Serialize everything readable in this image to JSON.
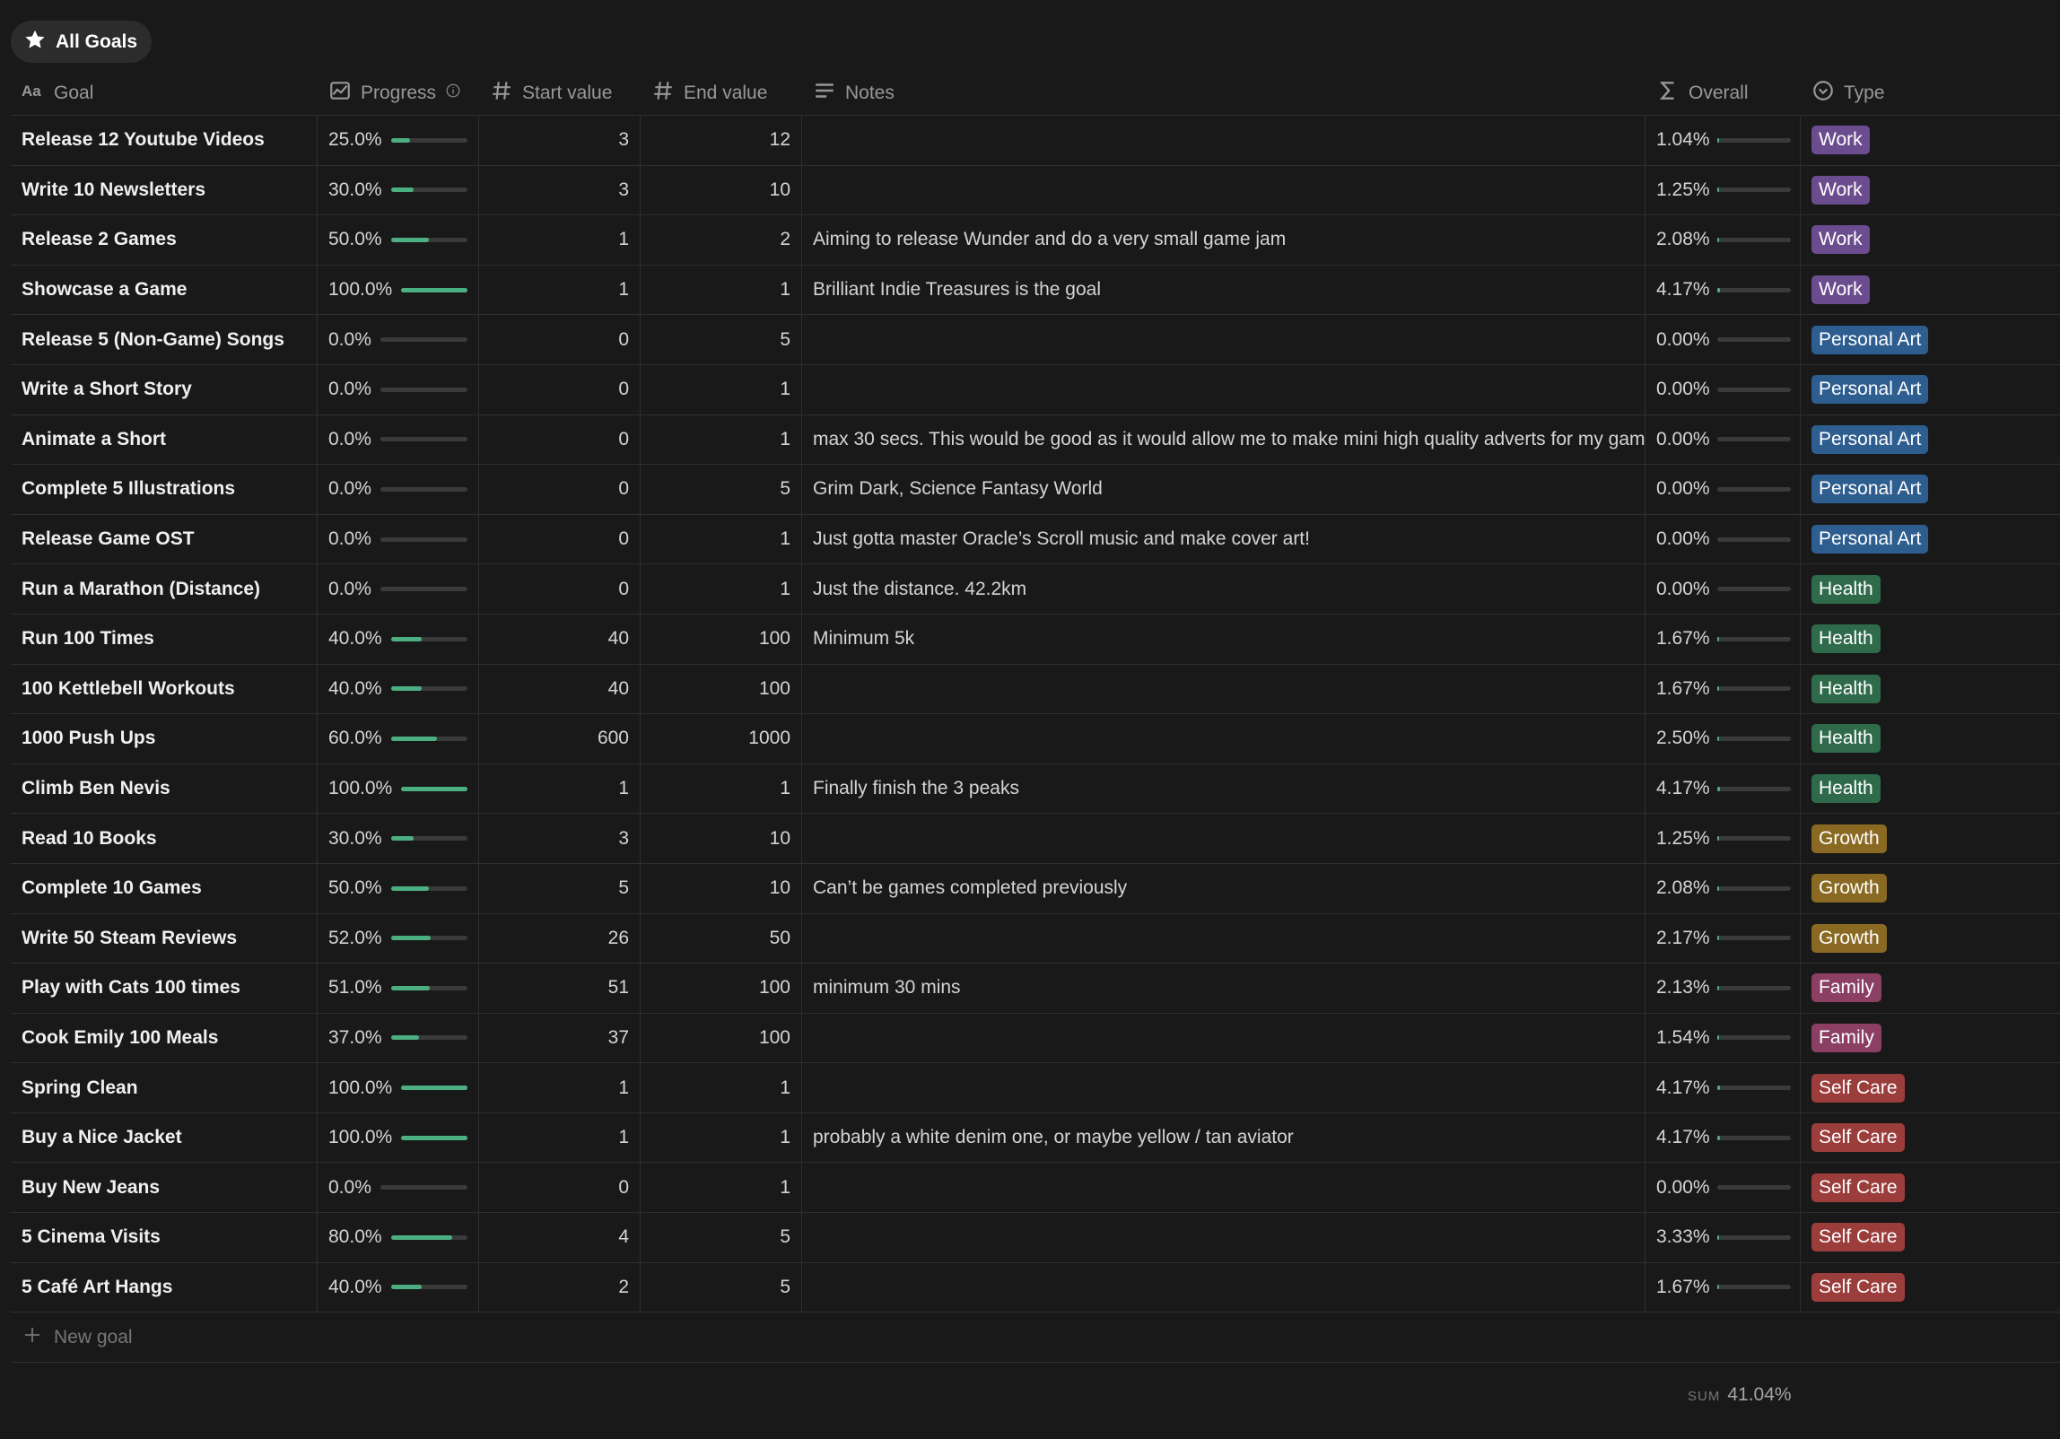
{
  "view": {
    "label": "All Goals",
    "icon": "star-icon"
  },
  "columns": {
    "goal": "Goal",
    "progress": "Progress",
    "start": "Start value",
    "end": "End value",
    "notes": "Notes",
    "overall": "Overall",
    "type": "Type"
  },
  "type_colors": {
    "Work": "#6b4c8f",
    "Personal Art": "#2e5d8f",
    "Health": "#2f6b4a",
    "Growth": "#8a6a22",
    "Family": "#8a3f63",
    "Self Care": "#9a3d3b"
  },
  "rows": [
    {
      "goal": "Release 12 Youtube Videos",
      "progress": "25.0%",
      "progress_value": 0.25,
      "start": "3",
      "end": "12",
      "notes": "",
      "overall": "1.04%",
      "overall_value": 0.0104,
      "type": "Work"
    },
    {
      "goal": "Write 10 Newsletters",
      "progress": "30.0%",
      "progress_value": 0.3,
      "start": "3",
      "end": "10",
      "notes": "",
      "overall": "1.25%",
      "overall_value": 0.0125,
      "type": "Work"
    },
    {
      "goal": "Release 2 Games",
      "progress": "50.0%",
      "progress_value": 0.5,
      "start": "1",
      "end": "2",
      "notes": "Aiming to release Wunder and do a very small game jam",
      "overall": "2.08%",
      "overall_value": 0.0208,
      "type": "Work"
    },
    {
      "goal": "Showcase a Game",
      "progress": "100.0%",
      "progress_value": 1.0,
      "start": "1",
      "end": "1",
      "notes": "Brilliant Indie Treasures is the goal",
      "overall": "4.17%",
      "overall_value": 0.0417,
      "type": "Work"
    },
    {
      "goal": "Release 5 (Non-Game) Songs",
      "progress": "0.0%",
      "progress_value": 0,
      "start": "0",
      "end": "5",
      "notes": "",
      "overall": "0.00%",
      "overall_value": 0,
      "type": "Personal Art"
    },
    {
      "goal": "Write a Short Story",
      "progress": "0.0%",
      "progress_value": 0,
      "start": "0",
      "end": "1",
      "notes": "",
      "overall": "0.00%",
      "overall_value": 0,
      "type": "Personal Art"
    },
    {
      "goal": "Animate a Short",
      "progress": "0.0%",
      "progress_value": 0,
      "start": "0",
      "end": "1",
      "notes": "max 30 secs. This would be good as it would allow me to make mini high quality adverts for my gam",
      "overall": "0.00%",
      "overall_value": 0,
      "type": "Personal Art"
    },
    {
      "goal": "Complete 5 Illustrations",
      "progress": "0.0%",
      "progress_value": 0,
      "start": "0",
      "end": "5",
      "notes": "Grim Dark, Science Fantasy World",
      "overall": "0.00%",
      "overall_value": 0,
      "type": "Personal Art"
    },
    {
      "goal": "Release Game OST",
      "progress": "0.0%",
      "progress_value": 0,
      "start": "0",
      "end": "1",
      "notes": "Just gotta master Oracle’s Scroll music and make cover art!",
      "overall": "0.00%",
      "overall_value": 0,
      "type": "Personal Art"
    },
    {
      "goal": "Run a Marathon (Distance)",
      "progress": "0.0%",
      "progress_value": 0,
      "start": "0",
      "end": "1",
      "notes": "Just the distance. 42.2km",
      "overall": "0.00%",
      "overall_value": 0,
      "type": "Health"
    },
    {
      "goal": "Run 100 Times",
      "progress": "40.0%",
      "progress_value": 0.4,
      "start": "40",
      "end": "100",
      "notes": "Minimum 5k",
      "overall": "1.67%",
      "overall_value": 0.0167,
      "type": "Health"
    },
    {
      "goal": "100 Kettlebell Workouts",
      "progress": "40.0%",
      "progress_value": 0.4,
      "start": "40",
      "end": "100",
      "notes": "",
      "overall": "1.67%",
      "overall_value": 0.0167,
      "type": "Health"
    },
    {
      "goal": "1000 Push Ups",
      "progress": "60.0%",
      "progress_value": 0.6,
      "start": "600",
      "end": "1000",
      "notes": "",
      "overall": "2.50%",
      "overall_value": 0.025,
      "type": "Health"
    },
    {
      "goal": "Climb Ben Nevis",
      "progress": "100.0%",
      "progress_value": 1.0,
      "start": "1",
      "end": "1",
      "notes": "Finally finish the 3 peaks",
      "overall": "4.17%",
      "overall_value": 0.0417,
      "type": "Health"
    },
    {
      "goal": "Read 10 Books",
      "progress": "30.0%",
      "progress_value": 0.3,
      "start": "3",
      "end": "10",
      "notes": "",
      "overall": "1.25%",
      "overall_value": 0.0125,
      "type": "Growth"
    },
    {
      "goal": "Complete 10 Games",
      "progress": "50.0%",
      "progress_value": 0.5,
      "start": "5",
      "end": "10",
      "notes": "Can’t be games completed previously",
      "overall": "2.08%",
      "overall_value": 0.0208,
      "type": "Growth"
    },
    {
      "goal": "Write 50 Steam Reviews",
      "progress": "52.0%",
      "progress_value": 0.52,
      "start": "26",
      "end": "50",
      "notes": "",
      "overall": "2.17%",
      "overall_value": 0.0217,
      "type": "Growth"
    },
    {
      "goal": "Play with Cats 100 times",
      "progress": "51.0%",
      "progress_value": 0.51,
      "start": "51",
      "end": "100",
      "notes": "minimum 30 mins",
      "overall": "2.13%",
      "overall_value": 0.0213,
      "type": "Family"
    },
    {
      "goal": "Cook Emily 100 Meals",
      "progress": "37.0%",
      "progress_value": 0.37,
      "start": "37",
      "end": "100",
      "notes": "",
      "overall": "1.54%",
      "overall_value": 0.0154,
      "type": "Family"
    },
    {
      "goal": "Spring Clean",
      "progress": "100.0%",
      "progress_value": 1.0,
      "start": "1",
      "end": "1",
      "notes": "",
      "overall": "4.17%",
      "overall_value": 0.0417,
      "type": "Self Care"
    },
    {
      "goal": "Buy a Nice Jacket",
      "progress": "100.0%",
      "progress_value": 1.0,
      "start": "1",
      "end": "1",
      "notes": "probably a white denim one, or maybe yellow / tan aviator",
      "overall": "4.17%",
      "overall_value": 0.0417,
      "type": "Self Care"
    },
    {
      "goal": "Buy New Jeans",
      "progress": "0.0%",
      "progress_value": 0,
      "start": "0",
      "end": "1",
      "notes": "",
      "overall": "0.00%",
      "overall_value": 0,
      "type": "Self Care"
    },
    {
      "goal": "5 Cinema Visits",
      "progress": "80.0%",
      "progress_value": 0.8,
      "start": "4",
      "end": "5",
      "notes": "",
      "overall": "3.33%",
      "overall_value": 0.0333,
      "type": "Self Care"
    },
    {
      "goal": "5 Café Art Hangs",
      "progress": "40.0%",
      "progress_value": 0.4,
      "start": "2",
      "end": "5",
      "notes": "",
      "overall": "1.67%",
      "overall_value": 0.0167,
      "type": "Self Care"
    }
  ],
  "new_row_label": "New goal",
  "footer": {
    "sum_label": "SUM",
    "sum_value": "41.04%"
  }
}
